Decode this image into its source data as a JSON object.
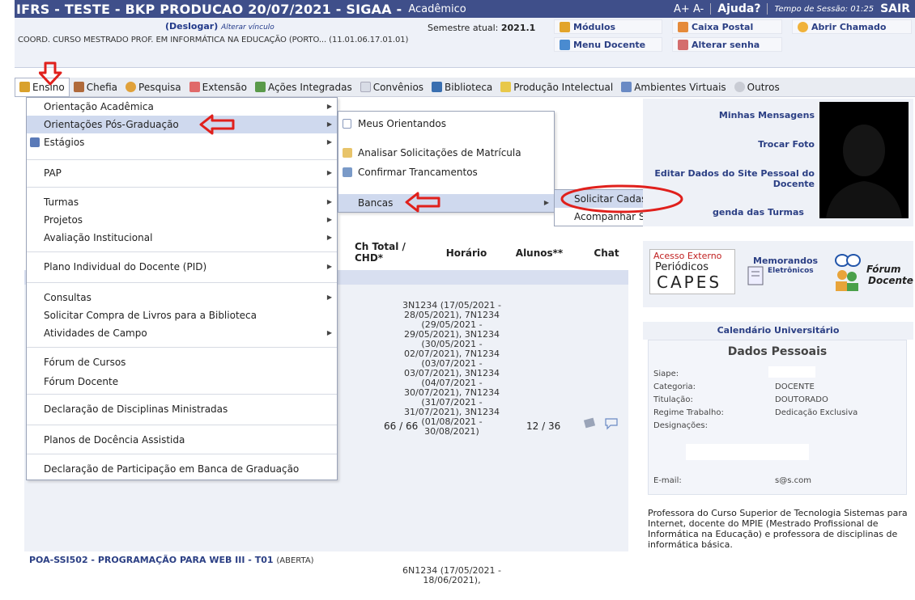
{
  "topbar": {
    "title": "IFRS - TESTE - BKP PRODUCAO 20/07/2021 - SIGAA -",
    "module": "Acadêmico",
    "font_controls": "A+ A-",
    "help": "Ajuda?",
    "session": "Tempo de Sessão: 01:25",
    "logout": "SAIR"
  },
  "infobar": {
    "deslogar": "(Deslogar)",
    "alterar_vinculo": "Alterar vínculo",
    "semestre_label": "Semestre atual:",
    "semestre_value": "2021.1",
    "unidade": "COORD. CURSO MESTRADO PROF. EM INFORMÁTICA NA EDUCAÇÃO (PORTO... (11.01.06.17.01.01)",
    "links": {
      "modulos": "Módulos",
      "caixa_postal": "Caixa Postal",
      "abrir_chamado": "Abrir Chamado",
      "menu_docente": "Menu Docente",
      "alterar_senha": "Alterar senha"
    }
  },
  "menubar": {
    "items": [
      "Ensino",
      "Chefia",
      "Pesquisa",
      "Extensão",
      "Ações Integradas",
      "Convênios",
      "Biblioteca",
      "Produção Intelectual",
      "Ambientes Virtuais",
      "Outros"
    ]
  },
  "dropdown": {
    "items": [
      "Orientação Acadêmica",
      "Orientações Pós-Graduação",
      "Estágios",
      "PAP",
      "Turmas",
      "Projetos",
      "Avaliação Institucional",
      "Plano Individual do Docente (PID)",
      "Consultas",
      "Solicitar Compra de Livros para a Biblioteca",
      "Atividades de Campo",
      "Fórum de Cursos",
      "Fórum Docente",
      "Declaração de Disciplinas Ministradas",
      "Planos de Docência Assistida",
      "Declaração de Participação em Banca de Graduação"
    ]
  },
  "submenu": {
    "items": [
      "Meus Orientandos",
      "Analisar Solicitações de Matrícula",
      "Confirmar Trancamentos",
      "Bancas"
    ]
  },
  "subsubmenu": {
    "items": [
      "Solicitar Cadastro",
      "Acompanhar Solicitação"
    ]
  },
  "table": {
    "headers": {
      "ch": "Ch Total / CHD*",
      "horario": "Horário",
      "alunos": "Alunos**",
      "chat": "Chat"
    },
    "row1": {
      "horario": "3N1234 (17/05/2021 - 28/05/2021), 7N1234 (29/05/2021 - 29/05/2021), 3N1234 (30/05/2021 - 02/07/2021), 7N1234 (03/07/2021 - 03/07/2021), 3N1234 (04/07/2021 - 30/07/2021), 7N1234 (31/07/2021 - 31/07/2021), 3N1234 (01/08/2021 - 30/08/2021)",
      "ch": "66 / 66",
      "alunos": "12 / 36"
    },
    "row2": {
      "course": "POA-SSI502 - PROGRAMAÇÃO PARA WEB III - T01",
      "status": "(ABERTA)",
      "horario": "6N1234 (17/05/2021 - 18/06/2021),"
    }
  },
  "right": {
    "minhas_mensagens": "Minhas Mensagens",
    "trocar_foto": "Trocar Foto",
    "editar_site": "Editar Dados do Site Pessoal do Docente",
    "agenda": "genda das Turmas",
    "banners": {
      "capes_top": "Acesso Externo",
      "capes_mid": "Periódicos",
      "capes_big": "CAPES",
      "memorandos": "Memorandos",
      "eletronicos": "Eletrônicos",
      "forum": "Fórum",
      "docente": "Docente"
    },
    "calendario": "Calendário Universitário",
    "dados": {
      "title": "Dados Pessoais",
      "siape": "Siape:",
      "categoria_label": "Categoria:",
      "categoria": "DOCENTE",
      "titulacao_label": "Titulação:",
      "titulacao": "DOUTORADO",
      "regime_label": "Regime Trabalho:",
      "regime": "Dedicação Exclusiva",
      "designacoes": "Designações:",
      "email_label": "E-mail:",
      "email": "s@s.com"
    },
    "bio": "Professora do Curso Superior de Tecnologia Sistemas para Internet, docente do MPIE (Mestrado Profissional de Informática na Educação) e professora de disciplinas de informática básica."
  },
  "colors": {
    "topbar": "#3f4f8a",
    "link": "#2b3f84",
    "highlight": "#cfd9ee",
    "annotation": "#e0201c"
  }
}
